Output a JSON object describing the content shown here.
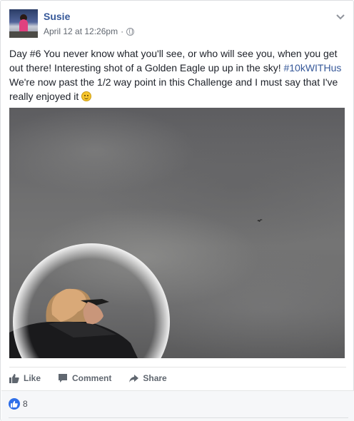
{
  "post": {
    "author": "Susie",
    "timestamp": "April 12 at 12:26pm",
    "separator": "·",
    "privacy_icon": "globe-icon",
    "menu_icon": "chevron-down-icon",
    "text_main": "Day #6 You never know what you'll see, or who will see you, when you get out there! Interesting shot of a Golden Eagle up up in the sky! ",
    "hashtag": "#10kWITHus",
    "text_after": " We're now past the 1/2 way point in this Challenge and I must say that I've really enjoyed it ",
    "emoji": "smile-emoji"
  },
  "actions": {
    "like": "Like",
    "comment": "Comment",
    "share": "Share"
  },
  "reactions": {
    "icon": "thumbs-up-icon",
    "count": "8"
  },
  "colors": {
    "link": "#365899",
    "text": "#1d2129",
    "muted": "#616770",
    "like_blue": "#2f6fe8"
  }
}
